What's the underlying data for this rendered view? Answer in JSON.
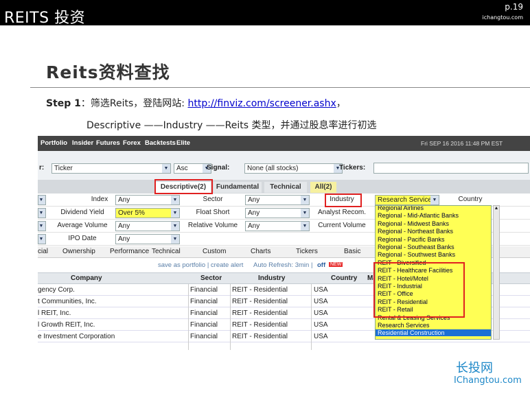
{
  "header": {
    "brand": "REITS 投资",
    "page": "p.19",
    "site": "ichangtou.com"
  },
  "title": "Reits资料查找",
  "step1": {
    "label": "Step 1",
    "text": "：筛选Reits，登陆网站: ",
    "link": "http://finviz.com/screener.ashx",
    "tail": "，"
  },
  "step2": "Descriptive ——Industry ——Reits 类型，并通过股息率进行初选",
  "watermark": {
    "line1": "长投网",
    "line2": "IChangtou.com"
  },
  "screenshot": {
    "nav": [
      "Portfolio",
      "Insider",
      "Futures",
      "Forex",
      "Backtests",
      "Elite"
    ],
    "date": "Fri SEP 16 2016 11:48 PM EST",
    "order": {
      "prefix": "r:",
      "order_value": "Ticker",
      "dir_value": "Asc",
      "signal_label": "Signal:",
      "signal_value": "None (all stocks)",
      "tickers_label": "Tickers:"
    },
    "tabs": [
      "Descriptive(2)",
      "Fundamental",
      "Technical",
      "All(2)"
    ],
    "filters": [
      {
        "name1": "Index",
        "val1": "Any",
        "name2": "Sector",
        "val2": "Any",
        "name3": "Industry",
        "val3": "Research Services",
        "name4": "Country"
      },
      {
        "name1": "Dividend Yield",
        "val1": "Over 5%",
        "name2": "Float Short",
        "val2": "Any",
        "name3": "Analyst Recom."
      },
      {
        "name1": "Average Volume",
        "val1": "Any",
        "name2": "Relative Volume",
        "val2": "Any",
        "name3": "Current Volume"
      },
      {
        "name1": "IPO Date",
        "val1": "Any"
      }
    ],
    "view_tabs": [
      "cial",
      "Ownership",
      "Performance",
      "Technical",
      "Custom",
      "Charts",
      "Tickers",
      "Basic"
    ],
    "toolbar": {
      "save": "save as portfolio | create alert",
      "refresh": "Auto Refresh: 3min |",
      "off": "off",
      "new": "NEW"
    },
    "columns": [
      "Company",
      "Sector",
      "Industry",
      "Country",
      "Ma"
    ],
    "rows": [
      [
        "gency Corp.",
        "Financial",
        "REIT - Residential",
        "USA"
      ],
      [
        "t Communities, Inc.",
        "Financial",
        "REIT - Residential",
        "USA"
      ],
      [
        "l REIT, Inc.",
        "Financial",
        "REIT - Residential",
        "USA"
      ],
      [
        "l Growth REIT, Inc.",
        "Financial",
        "REIT - Residential",
        "USA"
      ],
      [
        "e Investment Corporation",
        "Financial",
        "REIT - Residential",
        "USA"
      ]
    ],
    "dropdown": [
      "Regional Airlines",
      "Regional - Mid-Atlantic Banks",
      "Regional - Midwest Banks",
      "Regional - Northeast Banks",
      "Regional - Pacific Banks",
      "Regional - Southeast Banks",
      "Regional - Southwest Banks",
      "REIT - Diversified",
      "REIT - Healthcare Facilities",
      "REIT - Hotel/Motel",
      "REIT - Industrial",
      "REIT - Office",
      "REIT - Residential",
      "REIT - Retail",
      "Rental & Leasing Services",
      "Research Services",
      "Residential Construction"
    ],
    "dropdown_selected_index": 16
  },
  "colors": {
    "highlight_yellow": "#ffff55",
    "annotation_red": "#e02020",
    "link_blue": "#0000cc",
    "brand_blue": "#1e88c8"
  }
}
